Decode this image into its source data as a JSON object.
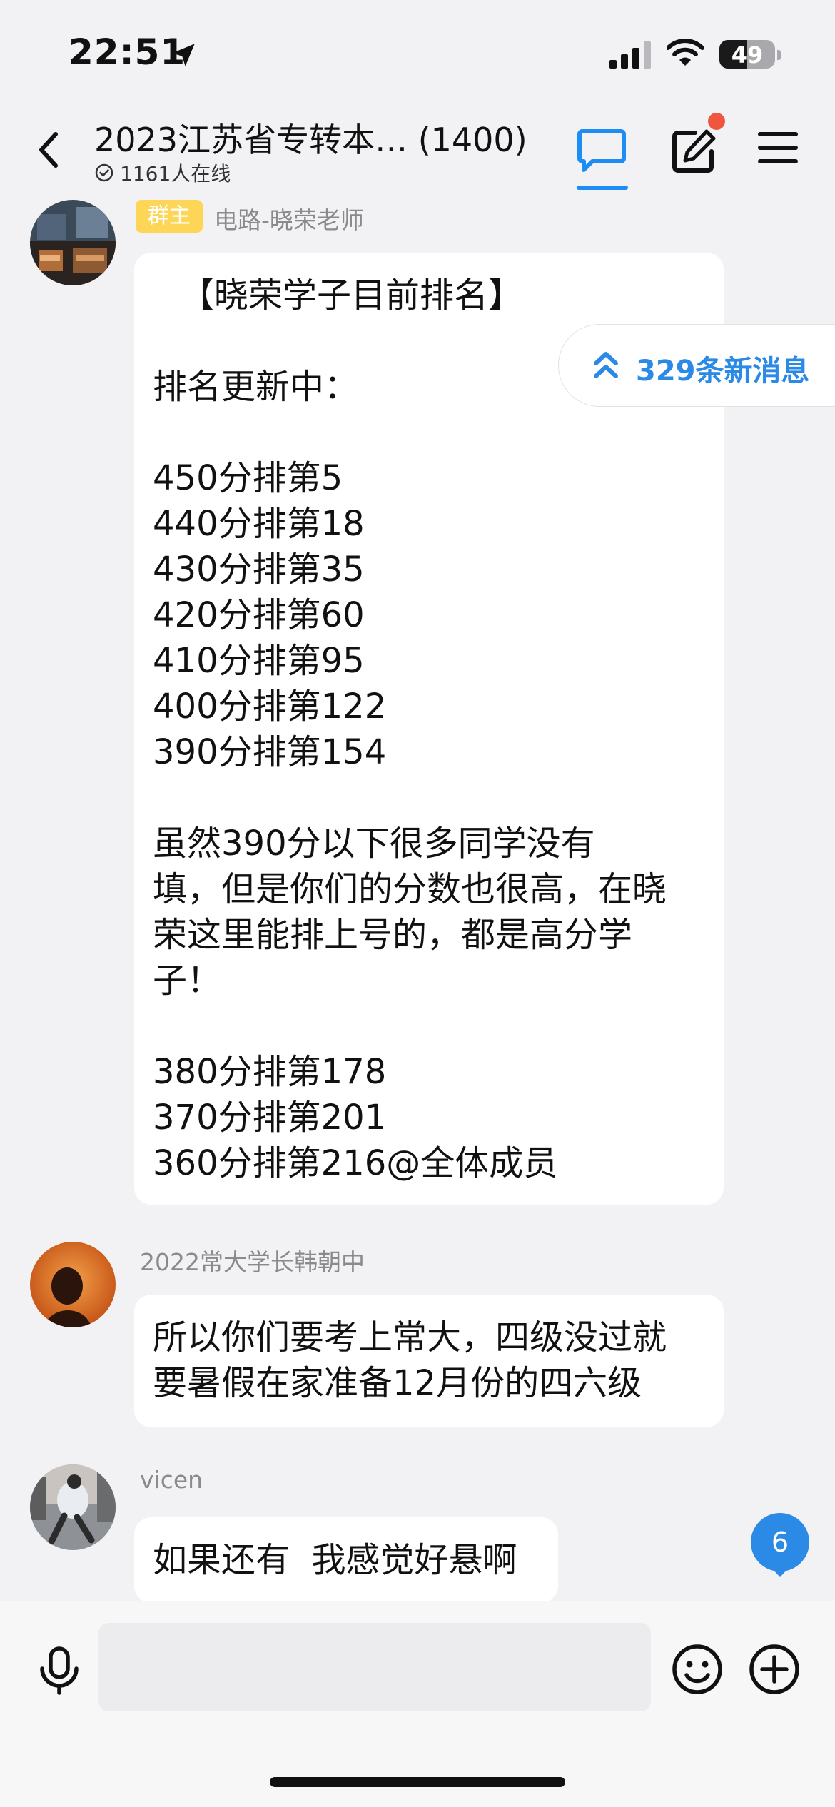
{
  "status_bar": {
    "time": "22:51",
    "battery": "49",
    "battery_level": 0.49
  },
  "header": {
    "title": "2023江苏省专转本… (1400)",
    "online": "1161人在线",
    "icons": [
      "back-icon",
      "chat-icon",
      "edit-icon",
      "menu-icon"
    ]
  },
  "new_messages": {
    "label": "329条新消息"
  },
  "messages": [
    {
      "role_badge": "群主",
      "sender": "电路-晓荣老师",
      "lines": [
        "【晓荣学子目前排名】",
        "",
        "排名更新中：",
        "",
        "450分排第5",
        "440分排第18",
        "430分排第35",
        "420分排第60",
        "410分排第95",
        "400分排第122",
        "390分排第154",
        "",
        "虽然390分以下很多同学没有",
        "填，但是你们的分数也很高，在晓",
        "荣这里能排上号的，都是高分学",
        "子！",
        "",
        "380分排第178",
        "370分排第201",
        "360分排第216@全体成员"
      ]
    },
    {
      "sender": "2022常大学长韩朝中",
      "lines": [
        "所以你们要考上常大，四级没过就",
        "要暑假在家准备12月份的四六级"
      ]
    },
    {
      "sender": "vicen",
      "lines": [
        "如果还有  我感觉好悬啊"
      ]
    }
  ],
  "unread_badge": "6",
  "input": {
    "placeholder": ""
  },
  "colors": {
    "accent": "#1e8cf5",
    "owner_badge": "#fdd658",
    "notification_dot": "#f0563f"
  }
}
